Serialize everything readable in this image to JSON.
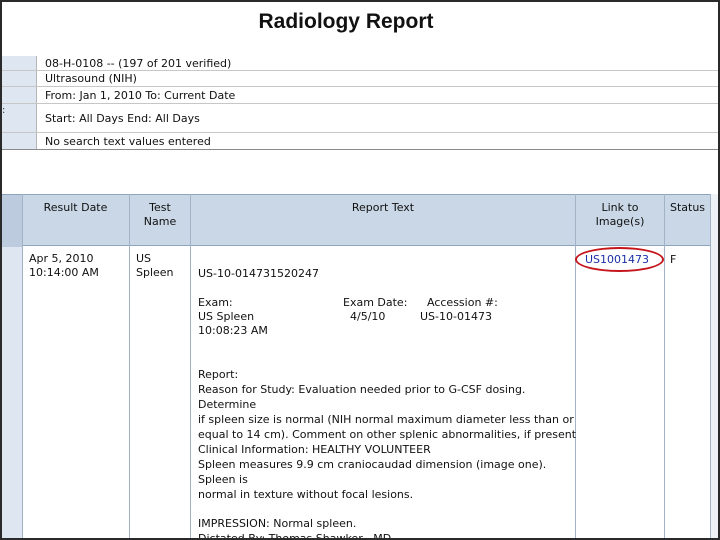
{
  "title": "Radiology Report",
  "criteria": {
    "patient": "08-H-0108 -- (197 of 201 verified)",
    "modality": "Ultrasound (NIH)",
    "date_range": "From: Jan 1, 2010 To: Current Date",
    "time_range": "Start: All Days  End: All Days",
    "search_text": "No search text values entered"
  },
  "table": {
    "headers": {
      "result_date": "Result Date",
      "test_name_1": "Test",
      "test_name_2": "Name",
      "report_text": "Report Text",
      "link_1": "Link to",
      "link_2": "Image(s)",
      "status": "Status"
    },
    "row": {
      "date": "Apr 5, 2010",
      "time": "10:14:00 AM",
      "test_1": "US",
      "test_2": "Spleen",
      "link": "US1001473",
      "status": "F",
      "report_id": "US-10-014731520247",
      "exam_label": "Exam:",
      "exam_date_label": "Exam Date:",
      "accession_label": "Accession #:",
      "exam_name": "US Spleen",
      "exam_date": "4/5/10",
      "accession": "US-10-01473",
      "exam_time": "10:08:23 AM",
      "report_lines": [
        "Report:",
        "Reason for Study: Evaluation needed prior to G-CSF dosing.",
        "Determine",
        "if spleen size is normal (NIH normal maximum diameter less than or",
        "equal to 14 cm). Comment on other splenic abnormalities, if present",
        "Clinical Information: HEALTHY VOLUNTEER",
        "Spleen measures 9.9 cm craniocaudad dimension (image one).",
        "Spleen is",
        "normal in texture without focal lesions."
      ],
      "impression": "IMPRESSION: Normal spleen.",
      "dictated": "Dictated By: Thomas Shawker , MD"
    }
  }
}
